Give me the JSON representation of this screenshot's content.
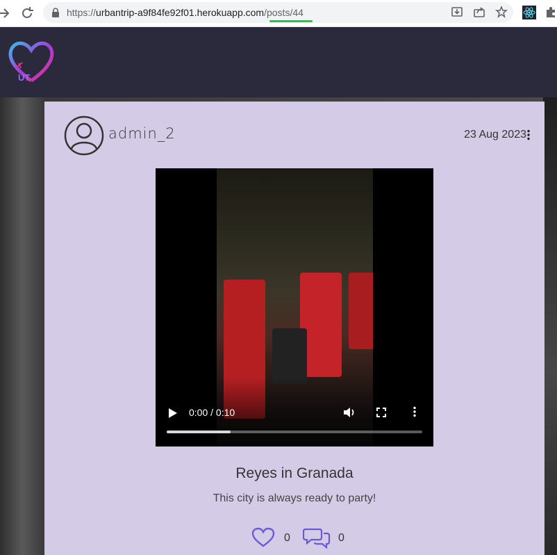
{
  "browser": {
    "url_prefix": "https://",
    "url_host": "urbantrip-a9f84fe92f01.herokuapp.com",
    "url_path": "/posts/44",
    "icons": [
      "back-arrow-icon",
      "reload-icon",
      "lock-icon",
      "install-icon",
      "share-icon",
      "star-icon",
      "react-devtools-icon",
      "extensions-icon"
    ]
  },
  "header": {
    "logo_text": "UT"
  },
  "post": {
    "author": "admin_2",
    "date": "23 Aug 2023",
    "title": "Reyes in Granada",
    "description": "This city is always ready to party!",
    "likes": "0",
    "comments": "0"
  },
  "video": {
    "time": "0:00 / 0:10",
    "progress_fraction": 0.25
  },
  "colors": {
    "header_bg": "#2b2a3d",
    "card_bg": "#d4cce6",
    "icon_accent": "#6a5ad6",
    "url_underline": "#22cc33"
  }
}
